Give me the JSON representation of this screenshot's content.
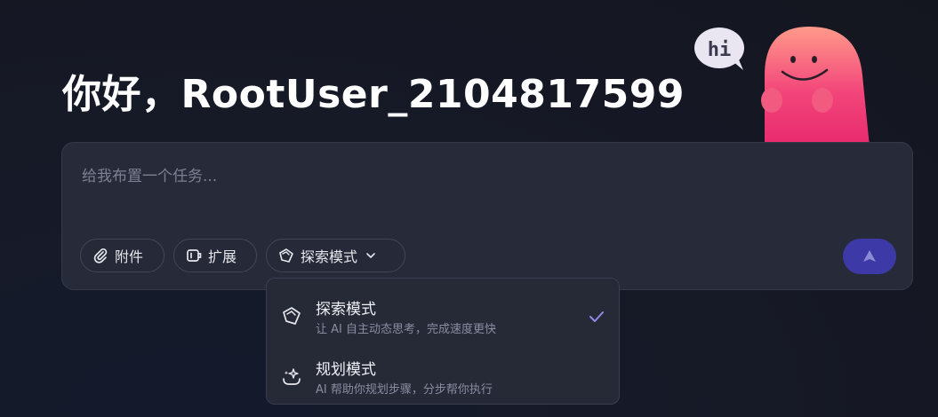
{
  "greeting": "你好，RootUser_2104817599",
  "mascot": {
    "bubble_text": "hi",
    "icon": "smiling-ghost-mascot"
  },
  "input": {
    "placeholder": "给我布置一个任务..."
  },
  "toolbar": {
    "attach_label": "附件",
    "extend_label": "扩展",
    "mode_label": "探索模式"
  },
  "dropdown": {
    "items": [
      {
        "title": "探索模式",
        "desc": "让 AI 自主动态思考，完成速度更快",
        "icon": "explore-icon",
        "selected": true
      },
      {
        "title": "规划模式",
        "desc": "AI 帮助你规划步骤，分步帮你执行",
        "icon": "plan-icon",
        "selected": false
      }
    ]
  },
  "colors": {
    "background": "#161a28",
    "card": "#272a38",
    "send_button": "#3d3aa8",
    "check": "#8f8ce8",
    "mascot": "#f2457a"
  }
}
